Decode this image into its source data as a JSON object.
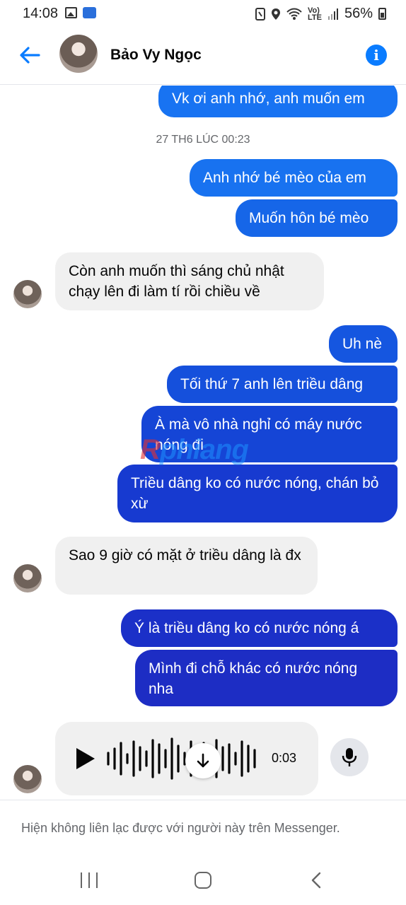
{
  "status_bar": {
    "time": "14:08",
    "volte_top": "Vo)",
    "volte_bottom": "LTE",
    "battery": "56%"
  },
  "header": {
    "contact_name": "Bảo Vy Ngọc",
    "back_icon": "arrow-left-icon",
    "info_icon": "info-icon"
  },
  "messages": {
    "m0": "Vk ơi anh nhớ, anh muốn em",
    "timestamp": "27 TH6 LÚC 00:23",
    "m1": "Anh nhớ bé mèo của em",
    "m2": "Muốn hôn bé mèo",
    "m3": "Còn anh muốn thì sáng chủ nhật chạy lên đi làm tí rồi chiều về",
    "m4": "Uh nè",
    "m5": "Tối thứ 7 anh lên triều dâng",
    "m6": "À mà vô nhà nghỉ có máy nước nóng đi",
    "m7": "Triều dâng ko có nước nóng, chán bỏ xừ",
    "m8": "Sao 9 giờ có mặt ở triều dâng là đx",
    "m9": "Ý là triều dâng ko có nước nóng á",
    "m10": "Mình đi chỗ khác có nước nóng nha"
  },
  "voice_message": {
    "duration": "0:03"
  },
  "watermark": {
    "red_part": "R",
    "blue_part": "phiang"
  },
  "notice": {
    "text": "Hiện không liên lạc được với người này trên Messenger."
  },
  "colors": {
    "accent": "#0a7cff",
    "bubble_in": "#f0f0f0",
    "bubble_out_top": "#1877f2",
    "bubble_out_bottom": "#1a2fc4"
  }
}
